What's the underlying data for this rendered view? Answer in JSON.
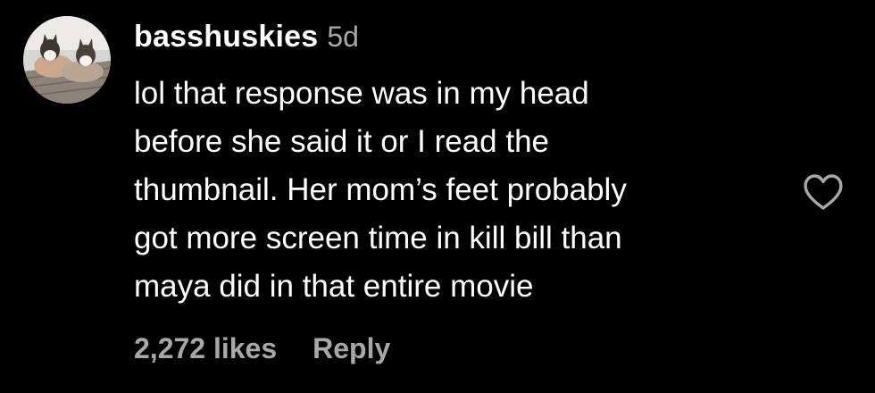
{
  "comment": {
    "username": "basshuskies",
    "time": "5d",
    "text_lines": [
      "lol that response was in my head",
      "before she said it or I read the",
      "thumbnail. Her mom’s feet probably",
      "got more screen time in kill bill than",
      "maya did in that entire movie"
    ],
    "likes": "2,272 likes",
    "reply_label": "Reply",
    "like_icon": "heart-outline"
  },
  "colors": {
    "background": "#000000",
    "primary_text": "#ffffff",
    "secondary_text": "#a8a8a8"
  }
}
